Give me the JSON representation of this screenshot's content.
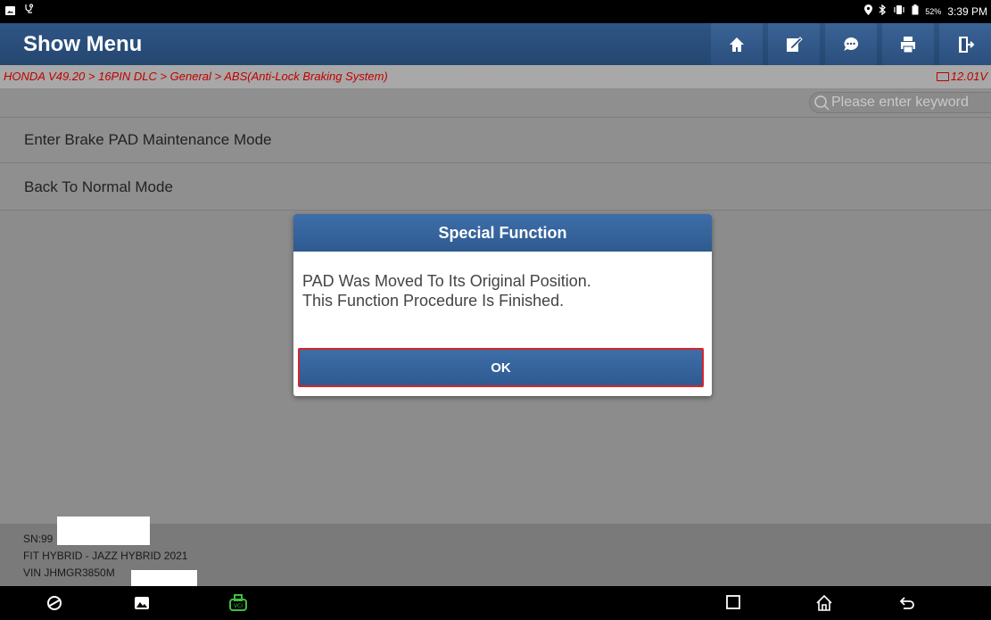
{
  "status_bar": {
    "left_icons": [
      "image-notification-icon",
      "vci-connection-icon"
    ],
    "right_icons": [
      "location-icon",
      "bluetooth-icon",
      "vibrate-icon",
      "battery-icon"
    ],
    "battery": "52%",
    "time": "3:39 PM"
  },
  "header": {
    "title": "Show Menu",
    "buttons": [
      "home-icon",
      "edit-report-icon",
      "feedback-icon",
      "print-icon",
      "exit-icon"
    ]
  },
  "breadcrumb": {
    "path": "HONDA V49.20 > 16PIN DLC > General > ABS(Anti-Lock Braking System)",
    "voltage": "12.01V"
  },
  "search": {
    "placeholder": "Please enter keyword"
  },
  "menu": {
    "items": [
      {
        "label": "Enter Brake PAD Maintenance Mode"
      },
      {
        "label": "Back To Normal Mode"
      }
    ]
  },
  "dialog": {
    "title": "Special Function",
    "message_line1": "PAD Was Moved To Its Original Position.",
    "message_line2": "This Function Procedure Is Finished.",
    "ok_label": "OK"
  },
  "vehicle_info": {
    "sn": "SN:99",
    "model": "FIT HYBRID - JAZZ HYBRID 2021",
    "vin": "VIN JHMGR3850M"
  },
  "colors": {
    "header_blue": "#2f5586",
    "breadcrumb_red": "#c00000",
    "highlight_red": "#d9232b",
    "vci_green": "#3fbf3f"
  }
}
